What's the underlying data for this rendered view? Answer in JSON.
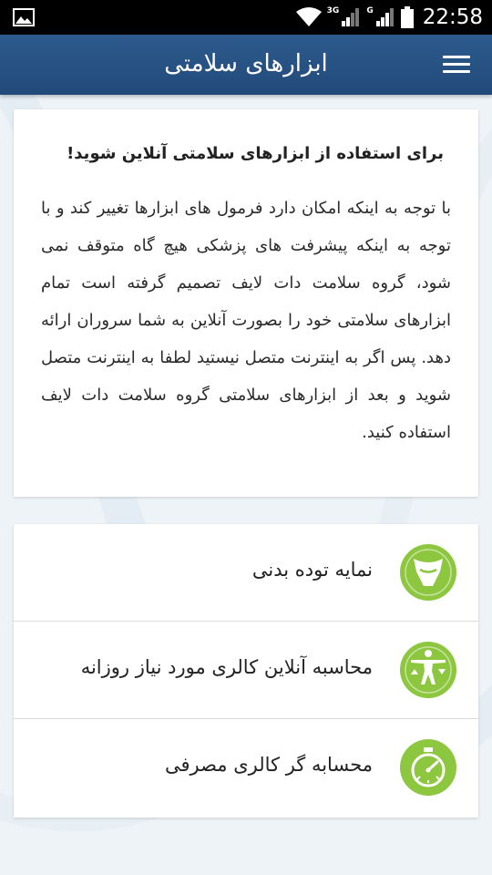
{
  "status_bar": {
    "time": "22:58",
    "network_1": "3G",
    "network_2": "G",
    "icons": [
      "gallery-icon",
      "wifi-icon",
      "signal-icon",
      "signal-icon",
      "battery-icon"
    ]
  },
  "app_bar": {
    "title": "ابزارهای سلامتی",
    "menu_icon": "hamburger-menu-icon"
  },
  "info": {
    "title": "برای استفاده از ابزارهای سلامتی آنلاین شوید!",
    "body": "با توجه به اینکه امکان دارد فرمول های ابزارها تغییر کند و با توجه به اینکه پیشرفت های پزشکی هیچ گاه متوقف نمی شود، گروه سلامت دات لایف تصمیم گرفته است تمام ابزارهای سلامتی خود را بصورت آنلاین به شما سروران ارائه دهد. پس اگر به اینترنت متصل نیستید لطفا به اینترنت متصل شوید و بعد از ابزارهای سلامتی گروه سلامت دات لایف استفاده کنید."
  },
  "tools": [
    {
      "label": "نمایه توده بدنی",
      "icon": "body-mass-icon"
    },
    {
      "label": "محاسبه آنلاین کالری مورد نیاز روزانه",
      "icon": "body-calorie-icon"
    },
    {
      "label": "محسابه گر کالری مصرفی",
      "icon": "stopwatch-icon"
    }
  ],
  "colors": {
    "app_bar": "#2d5a8e",
    "icon_green": "#8dc63f"
  }
}
